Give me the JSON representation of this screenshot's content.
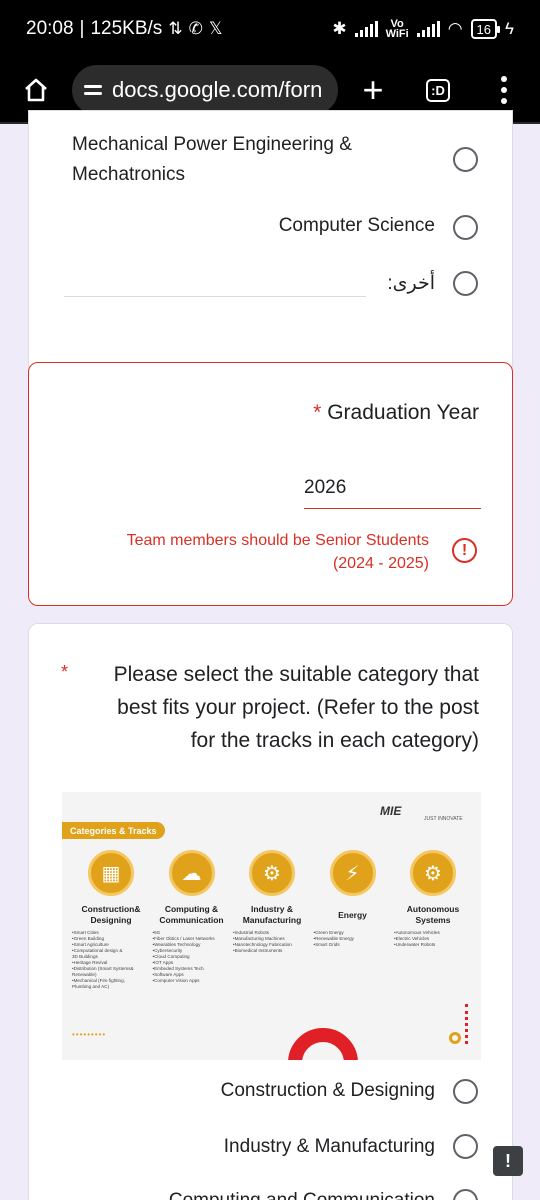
{
  "status_bar": {
    "time": "20:08",
    "speed": "125KB/s",
    "volte_line1": "Vo",
    "volte_line2": "WiFi",
    "battery": "16"
  },
  "browser": {
    "url": "docs.google.com/forn",
    "tab_count": ":D"
  },
  "department_question": {
    "options": [
      {
        "label": "Mechanical Power Engineering & Mechatronics",
        "line1": "Mechanical Power Engineering &",
        "line2": "Mechatronics",
        "selected": false
      },
      {
        "label": "Computer Science",
        "selected": false
      },
      {
        "label": "أخرى:",
        "selected": false
      }
    ]
  },
  "graduation_question": {
    "required_mark": "*",
    "title": "Graduation Year",
    "value": "2026",
    "error_line1": "Team members should be Senior Students",
    "error_line2": "(2024 - 2025)",
    "error_icon": "!"
  },
  "category_question": {
    "required_mark": "*",
    "title_line1": "Please select the suitable category that",
    "title_line2": "best fits your project. (Refer to the post",
    "title_line3": "for the tracks in each category)",
    "image": {
      "banner": "Categories & Tracks",
      "logo": "MIE",
      "logo_sub": "JUST INNOVATE",
      "categories": [
        {
          "name_line1": "Construction&",
          "name_line2": "Designing",
          "color": "#e0a21b",
          "tracks": [
            "•Smart Cities",
            "•Green Building",
            "•Smart Agriculture",
            "•Computational design &",
            "3D Buildings",
            "•Heritage Revival",
            "•Distribution (Smart Systems&",
            "Renewable)",
            "•Mechanical (Fire fighting,",
            "Plumbing and AC)"
          ]
        },
        {
          "name_line1": "Computing &",
          "name_line2": "Communication",
          "color": "#e0a21b",
          "tracks": [
            "•5G",
            "•Fiber Obtics / Laser Networks",
            "•Wearables Technology",
            "•Cybersecurity",
            "•Cloud Computing",
            "•IOT Apps",
            "•Embeded Systems Tech.",
            "•Software Apps",
            "•Computer Vision Apps"
          ]
        },
        {
          "name_line1": "Industry &",
          "name_line2": "Manufacturing",
          "color": "#e0a21b",
          "tracks": [
            "•Industrial Robots",
            "•Manufacturing Machines",
            "•Nanotechnology Fabrication",
            "•Biomedical Instruments"
          ]
        },
        {
          "name_line1": "Energy",
          "name_line2": "",
          "color": "#e0a21b",
          "tracks": [
            "•Green Energy",
            "•Renewable Energy",
            "•Smart Grids"
          ]
        },
        {
          "name_line1": "Autonomous",
          "name_line2": "Systems",
          "color": "#e0a21b",
          "tracks": [
            "•Autonomous Vehicles",
            "•Electric Vehicles",
            "•Underwater Robots"
          ]
        }
      ]
    },
    "options": [
      {
        "label": "Construction & Designing",
        "selected": false
      },
      {
        "label": "Industry & Manufacturing",
        "selected": false
      },
      {
        "label": "Computing and Communication",
        "selected": false
      }
    ]
  },
  "colors": {
    "error": "#d93025",
    "accent": "#673ab7",
    "page_bg": "#f0ebf8"
  }
}
